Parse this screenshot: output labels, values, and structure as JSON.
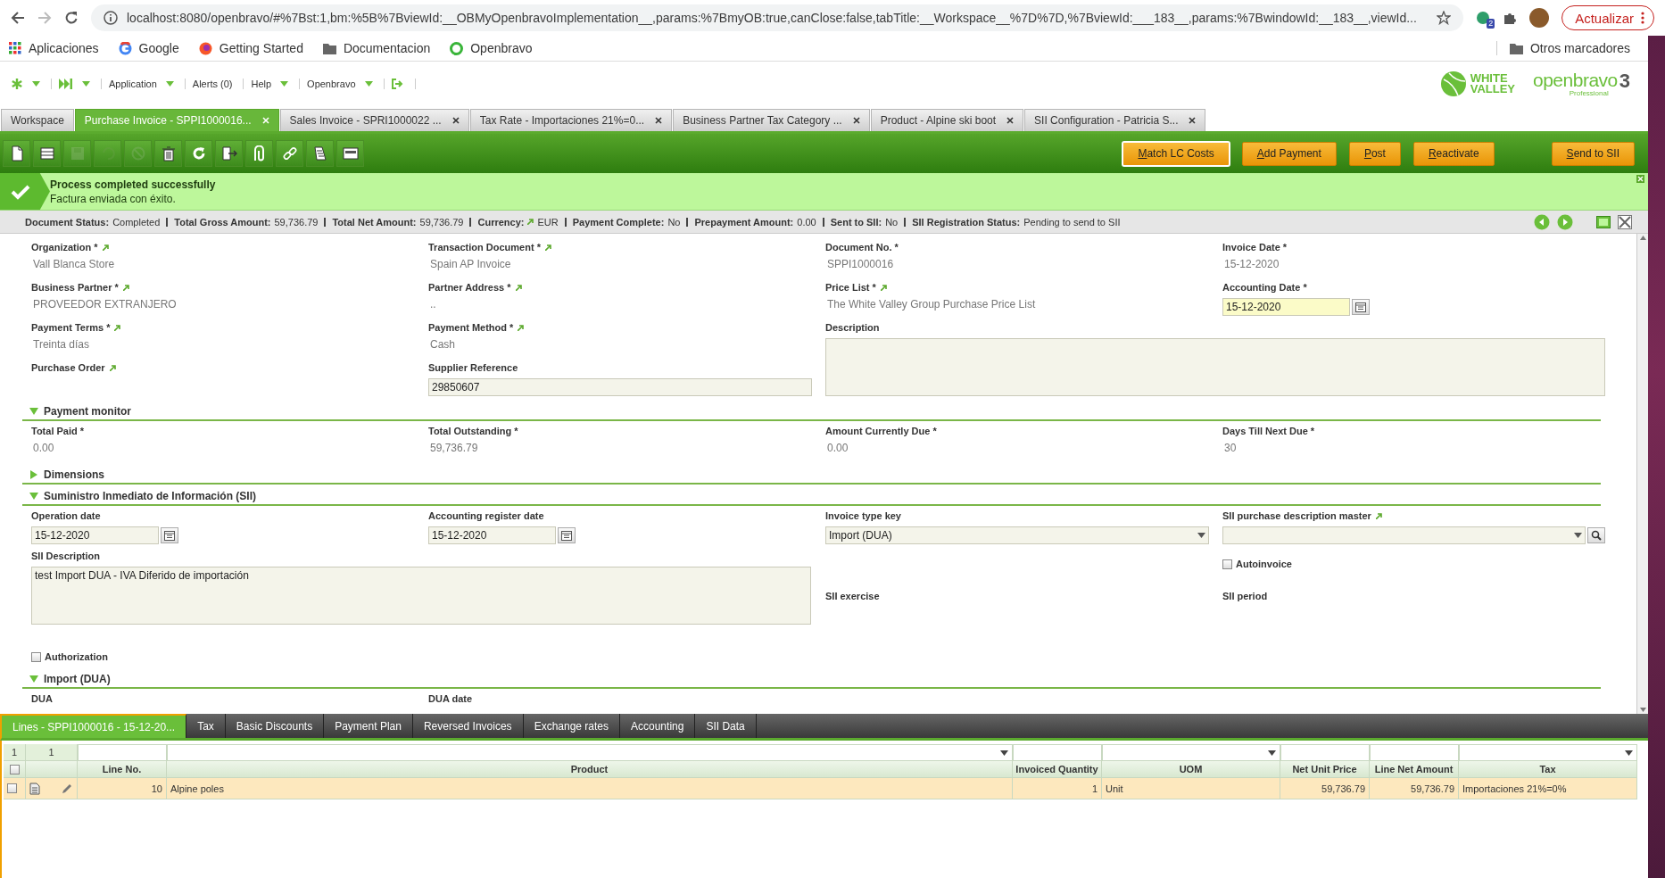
{
  "browser": {
    "url": "localhost:8080/openbravo/#%7Bst:1,bm:%5B%7BviewId:__OBMyOpenbravoImplementation__,params:%7BmyOB:true,canClose:false,tabTitle:__Workspace__%7D%7D,%7BviewId:___183__,params:%7BwindowId:__183__,viewId...",
    "extension_badge": "2",
    "update_button": "Actualizar",
    "bookmarks": [
      {
        "kind": "apps",
        "label": "Aplicaciones"
      },
      {
        "kind": "google",
        "label": "Google"
      },
      {
        "kind": "firefox",
        "label": "Getting Started"
      },
      {
        "kind": "folder",
        "label": "Documentacion"
      },
      {
        "kind": "openbravo",
        "label": "Openbravo"
      }
    ],
    "other_bookmarks": "Otros marcadores"
  },
  "navbar": {
    "menus": [
      {
        "label": "Application",
        "dropdown": true
      },
      {
        "label": "Alerts (0)",
        "dropdown": false
      },
      {
        "label": "Help",
        "dropdown": true
      },
      {
        "label": "Openbravo",
        "dropdown": true
      }
    ]
  },
  "logos": {
    "company_lines": [
      "WHITE",
      "VALLEY"
    ],
    "product": "openbravo",
    "edition": "Professional",
    "version": "3"
  },
  "window_tabs": [
    {
      "label": "Workspace",
      "selected": false,
      "closable": false
    },
    {
      "label": "Purchase Invoice - SPPI1000016...",
      "selected": true,
      "closable": true
    },
    {
      "label": "Sales Invoice - SPRI1000022 ...",
      "selected": false,
      "closable": true
    },
    {
      "label": "Tax Rate - Importaciones 21%=0...",
      "selected": false,
      "closable": true
    },
    {
      "label": "Business Partner Tax Category ...",
      "selected": false,
      "closable": true
    },
    {
      "label": "Product - Alpine ski boot",
      "selected": false,
      "closable": true
    },
    {
      "label": "SII Configuration - Patricia S...",
      "selected": false,
      "closable": true
    }
  ],
  "toolbar": {
    "icons": [
      {
        "kind": "new",
        "disabled": false
      },
      {
        "kind": "new_grid",
        "disabled": false
      },
      {
        "kind": "save",
        "disabled": true
      },
      {
        "kind": "undo",
        "disabled": true
      },
      {
        "kind": "cancel",
        "disabled": true
      },
      {
        "kind": "delete",
        "disabled": false
      },
      {
        "kind": "refresh",
        "disabled": false
      },
      {
        "kind": "export",
        "disabled": false
      },
      {
        "kind": "attach",
        "disabled": false
      },
      {
        "kind": "link",
        "disabled": false
      },
      {
        "kind": "tools",
        "disabled": false
      },
      {
        "kind": "grid",
        "disabled": false
      }
    ],
    "buttons": [
      {
        "label": "Match LC Costs",
        "focused": true
      },
      {
        "label": "Add Payment",
        "focused": false
      },
      {
        "label": "Post",
        "focused": false
      },
      {
        "label": "Reactivate",
        "focused": false
      },
      {
        "label": "Send to SII",
        "focused": false
      }
    ]
  },
  "message": {
    "title": "Process completed successfully",
    "text": "Factura enviada con éxito."
  },
  "status": [
    {
      "label": "Document Status:",
      "value": "Completed",
      "link": false
    },
    {
      "label": "Total Gross Amount:",
      "value": "59,736.79",
      "link": false
    },
    {
      "label": "Total Net Amount:",
      "value": "59,736.79",
      "link": false
    },
    {
      "label": "Currency:",
      "value": "EUR",
      "link": true
    },
    {
      "label": "Payment Complete:",
      "value": "No",
      "link": false
    },
    {
      "label": "Prepayment Amount:",
      "value": "0.00",
      "link": false
    },
    {
      "label": "Sent to SII:",
      "value": "No",
      "link": false
    },
    {
      "label": "SII Registration Status:",
      "value": "Pending to send to SII",
      "link": false
    }
  ],
  "form": {
    "fields": [
      {
        "kind": "text",
        "label": "Organization *",
        "link": true,
        "value": "Vall Blanca Store"
      },
      {
        "kind": "text",
        "label": "Transaction Document *",
        "link": true,
        "value": "Spain AP Invoice"
      },
      {
        "kind": "text",
        "label": "Document No. *",
        "link": false,
        "value": "SPPI1000016"
      },
      {
        "kind": "text",
        "label": "Invoice Date *",
        "link": false,
        "value": "15-12-2020"
      },
      {
        "kind": "text",
        "label": "Business Partner *",
        "link": true,
        "value": "PROVEEDOR EXTRANJERO"
      },
      {
        "kind": "text",
        "label": "Partner Address *",
        "link": true,
        "value": ".."
      },
      {
        "kind": "text",
        "label": "Price List *",
        "link": true,
        "value": "The White Valley Group Purchase Price List"
      },
      {
        "kind": "date",
        "label": "Accounting Date *",
        "link": false,
        "value": "15-12-2020",
        "highlighted": true
      },
      {
        "kind": "text",
        "label": "Payment Terms *",
        "link": true,
        "value": "Treinta días"
      },
      {
        "kind": "text",
        "label": "Payment Method *",
        "link": true,
        "value": "Cash"
      },
      {
        "kind": "textarea",
        "label": "Description",
        "link": false,
        "highlighted": false
      },
      {
        "kind": "label",
        "label": "Purchase Order",
        "link": true
      },
      {
        "kind": "input",
        "label": "Supplier Reference",
        "link": false,
        "value": "29850607",
        "highlighted": false
      }
    ],
    "sections": [
      {
        "title": "Payment monitor",
        "expanded": true,
        "fields": [
          {
            "kind": "text",
            "label": "Total Paid *",
            "link": false,
            "value": "0.00"
          },
          {
            "kind": "text",
            "label": "Total Outstanding *",
            "link": false,
            "value": "59,736.79"
          },
          {
            "kind": "text",
            "label": "Amount Currently Due *",
            "link": false,
            "value": "0.00"
          },
          {
            "kind": "text",
            "label": "Days Till Next Due *",
            "link": false,
            "value": "30"
          }
        ]
      },
      {
        "title": "Dimensions",
        "expanded": false
      },
      {
        "title": "Suministro Inmediato de Información (SII)",
        "expanded": true,
        "fields": [
          {
            "kind": "date",
            "label": "Operation date",
            "link": false,
            "value": "15-12-2020",
            "highlighted": false
          },
          {
            "kind": "date",
            "label": "Accounting register date",
            "link": false,
            "value": "15-12-2020",
            "highlighted": false
          },
          {
            "kind": "select",
            "label": "Invoice type key",
            "link": false,
            "value": "Import (DUA)",
            "highlighted": false
          },
          {
            "kind": "search",
            "label": "SII purchase description master",
            "link": true,
            "highlighted": false
          },
          {
            "kind": "textarea",
            "label": "SII Description",
            "link": false,
            "value": "test Import DUA - IVA Diferido de importación",
            "highlighted": false
          },
          {
            "kind": "checkbox",
            "label": "Autoinvoice",
            "link": false,
            "checked": false
          },
          {
            "kind": "label",
            "label": "SII exercise",
            "link": false
          },
          {
            "kind": "label",
            "label": "SII period",
            "link": false
          }
        ],
        "options": [
          {
            "kind": "checkbox",
            "label": "Authorization",
            "link": false,
            "checked": false
          }
        ]
      },
      {
        "title": "Import (DUA)",
        "expanded": true,
        "fields": [
          {
            "kind": "label",
            "label": "DUA",
            "link": false
          },
          {
            "kind": "label",
            "label": "DUA date",
            "link": false
          }
        ]
      }
    ]
  },
  "child_tabs": [
    {
      "label": "Lines - SPPI1000016 - 15-12-20...",
      "selected": true
    },
    {
      "label": "Tax",
      "selected": false
    },
    {
      "label": "Basic Discounts",
      "selected": false
    },
    {
      "label": "Payment Plan",
      "selected": false
    },
    {
      "label": "Reversed Invoices",
      "selected": false
    },
    {
      "label": "Exchange rates",
      "selected": false
    },
    {
      "label": "Accounting",
      "selected": false
    },
    {
      "label": "SII Data",
      "selected": false
    }
  ],
  "grid": {
    "counts": [
      "1",
      "1"
    ],
    "all_checked": false,
    "columns": [
      {
        "label": "Line No.",
        "kind": "number",
        "filter_dropdown": false
      },
      {
        "label": "Product",
        "kind": "text",
        "filter_dropdown": true
      },
      {
        "label": "Invoiced Quantity",
        "kind": "number",
        "filter_dropdown": false
      },
      {
        "label": "UOM",
        "kind": "text",
        "filter_dropdown": true
      },
      {
        "label": "Net Unit Price",
        "kind": "number",
        "filter_dropdown": false
      },
      {
        "label": "Line Net Amount",
        "kind": "number",
        "filter_dropdown": false
      },
      {
        "label": "Tax",
        "kind": "text",
        "filter_dropdown": true
      }
    ],
    "rows": [
      {
        "selected": true,
        "checked": false,
        "cells": [
          "10",
          "Alpine poles",
          "1",
          "Unit",
          "59,736.79",
          "59,736.79",
          "Importaciones 21%=0%"
        ]
      }
    ]
  }
}
